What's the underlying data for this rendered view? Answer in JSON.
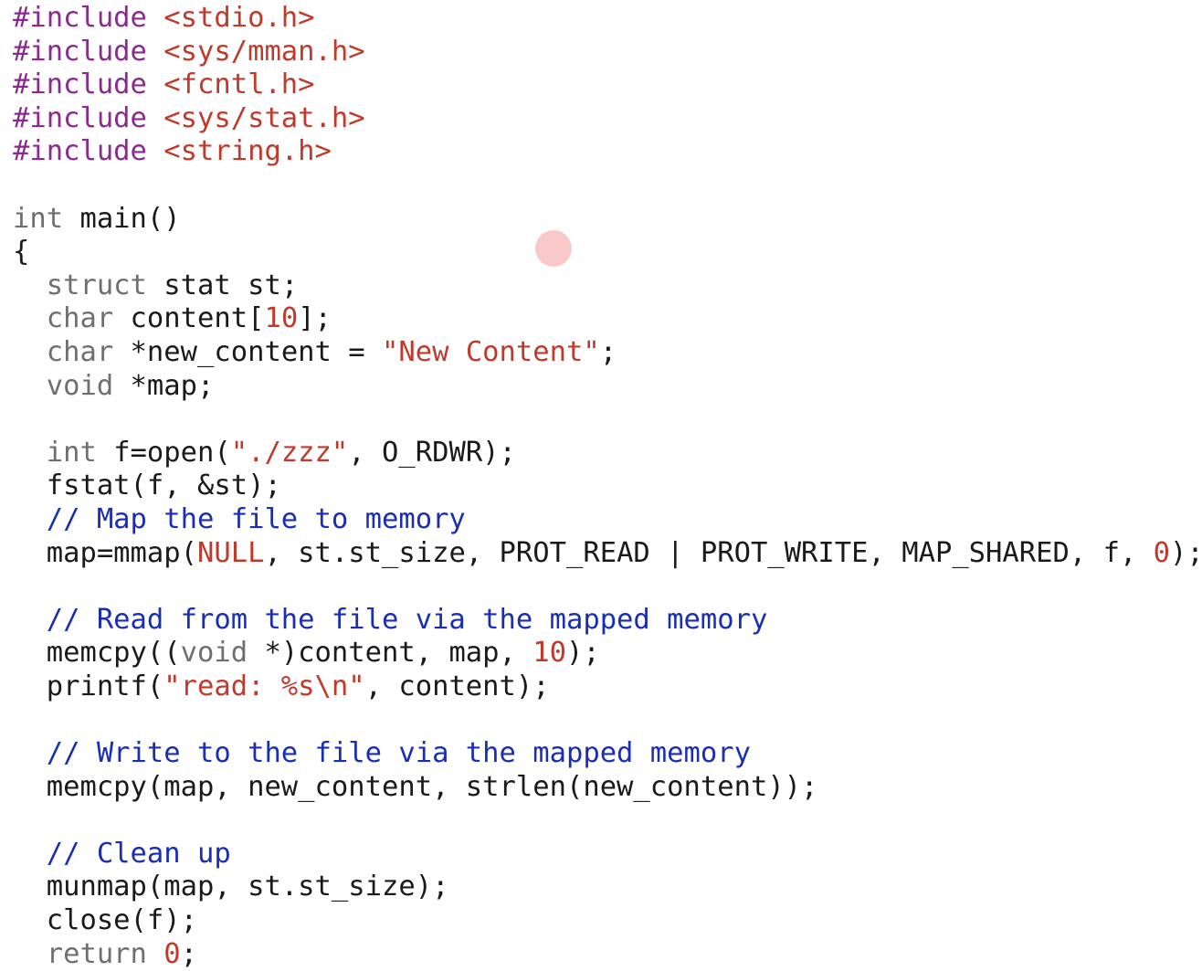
{
  "editor": {
    "lines": [
      [
        {
          "t": "#include ",
          "c": "pre"
        },
        {
          "t": "<stdio.h>",
          "c": "str"
        }
      ],
      [
        {
          "t": "#include ",
          "c": "pre"
        },
        {
          "t": "<sys/mman.h>",
          "c": "str"
        }
      ],
      [
        {
          "t": "#include ",
          "c": "pre"
        },
        {
          "t": "<fcntl.h>",
          "c": "str"
        }
      ],
      [
        {
          "t": "#include ",
          "c": "pre"
        },
        {
          "t": "<sys/stat.h>",
          "c": "str"
        }
      ],
      [
        {
          "t": "#include ",
          "c": "pre"
        },
        {
          "t": "<string.h>",
          "c": "str"
        }
      ],
      [],
      [
        {
          "t": "int",
          "c": "kw"
        },
        {
          "t": " main()",
          "c": "plain"
        }
      ],
      [
        {
          "t": "{",
          "c": "plain"
        }
      ],
      [
        {
          "t": "  ",
          "c": "plain"
        },
        {
          "t": "struct",
          "c": "kw"
        },
        {
          "t": " stat st;",
          "c": "plain"
        }
      ],
      [
        {
          "t": "  ",
          "c": "plain"
        },
        {
          "t": "char",
          "c": "kw"
        },
        {
          "t": " content[",
          "c": "plain"
        },
        {
          "t": "10",
          "c": "num"
        },
        {
          "t": "];",
          "c": "plain"
        }
      ],
      [
        {
          "t": "  ",
          "c": "plain"
        },
        {
          "t": "char",
          "c": "kw"
        },
        {
          "t": " *new_content = ",
          "c": "plain"
        },
        {
          "t": "\"New Content\"",
          "c": "str"
        },
        {
          "t": ";",
          "c": "plain"
        }
      ],
      [
        {
          "t": "  ",
          "c": "plain"
        },
        {
          "t": "void",
          "c": "kw"
        },
        {
          "t": " *map;",
          "c": "plain"
        }
      ],
      [],
      [
        {
          "t": "  ",
          "c": "plain"
        },
        {
          "t": "int",
          "c": "kw"
        },
        {
          "t": " f=open(",
          "c": "plain"
        },
        {
          "t": "\"./zzz\"",
          "c": "str"
        },
        {
          "t": ", O_RDWR);",
          "c": "plain"
        }
      ],
      [
        {
          "t": "  fstat(f, &st);",
          "c": "plain"
        }
      ],
      [
        {
          "t": "  ",
          "c": "plain"
        },
        {
          "t": "// Map the file to memory",
          "c": "comment"
        }
      ],
      [
        {
          "t": "  map=mmap(",
          "c": "plain"
        },
        {
          "t": "NULL",
          "c": "str"
        },
        {
          "t": ", st.st_size, PROT_READ | PROT_WRITE, MAP_SHARED, f, ",
          "c": "plain"
        },
        {
          "t": "0",
          "c": "num"
        },
        {
          "t": ");",
          "c": "plain"
        }
      ],
      [],
      [
        {
          "t": "  ",
          "c": "plain"
        },
        {
          "t": "// Read from the file via the mapped memory",
          "c": "comment"
        }
      ],
      [
        {
          "t": "  memcpy((",
          "c": "plain"
        },
        {
          "t": "void",
          "c": "kw"
        },
        {
          "t": " *)content, map, ",
          "c": "plain"
        },
        {
          "t": "10",
          "c": "num"
        },
        {
          "t": ");",
          "c": "plain"
        }
      ],
      [
        {
          "t": "  printf(",
          "c": "plain"
        },
        {
          "t": "\"read: %s\\n\"",
          "c": "str"
        },
        {
          "t": ", content);",
          "c": "plain"
        }
      ],
      [],
      [
        {
          "t": "  ",
          "c": "plain"
        },
        {
          "t": "// Write to the file via the mapped memory",
          "c": "comment"
        }
      ],
      [
        {
          "t": "  memcpy(map, new_content, strlen(new_content));",
          "c": "plain"
        }
      ],
      [],
      [
        {
          "t": "  ",
          "c": "plain"
        },
        {
          "t": "// Clean up",
          "c": "comment"
        }
      ],
      [
        {
          "t": "  munmap(map, st.st_size);",
          "c": "plain"
        }
      ],
      [
        {
          "t": "  close(f);",
          "c": "plain"
        }
      ],
      [
        {
          "t": "  ",
          "c": "plain"
        },
        {
          "t": "return",
          "c": "kw"
        },
        {
          "t": " ",
          "c": "plain"
        },
        {
          "t": "0",
          "c": "num"
        },
        {
          "t": ";",
          "c": "plain"
        }
      ]
    ]
  },
  "colors": {
    "preprocessor": "#8a2a8f",
    "keyword": "#6f6f6f",
    "string": "#c0392b",
    "number": "#c0392b",
    "comment": "#1a2db5",
    "text": "#1a1a1a",
    "cursor_highlight": "#f7b7b7"
  }
}
